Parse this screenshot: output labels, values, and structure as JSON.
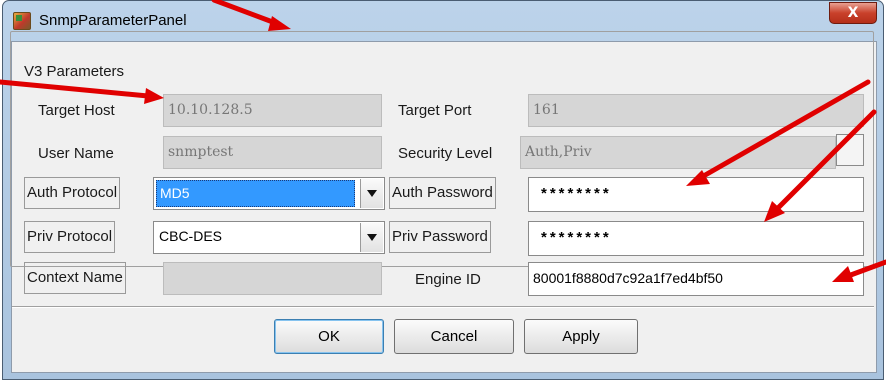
{
  "window": {
    "title": "SnmpParameterPanel",
    "close_glyph": "X"
  },
  "group": {
    "label": "V3 Parameters"
  },
  "fields": {
    "target_host": {
      "label": "Target Host",
      "value": "10.10.128.5"
    },
    "target_port": {
      "label": "Target Port",
      "value": "161"
    },
    "user_name": {
      "label": "User Name",
      "value": "snmptest"
    },
    "security_level": {
      "label": "Security Level",
      "value": "Auth,Priv"
    },
    "auth_protocol": {
      "label": "Auth Protocol",
      "value": "MD5"
    },
    "auth_password": {
      "label": "Auth Password",
      "value": "********"
    },
    "priv_protocol": {
      "label": "Priv Protocol",
      "value": "CBC-DES"
    },
    "priv_password": {
      "label": "Priv Password",
      "value": "********"
    },
    "context_name": {
      "label": "Context Name",
      "value": ""
    },
    "engine_id": {
      "label": "Engine ID",
      "value": "80001f8880d7c92a1f7ed4bf50"
    }
  },
  "buttons": {
    "ok": "OK",
    "cancel": "Cancel",
    "apply": "Apply"
  },
  "icons": {
    "app": "app-icon",
    "close": "close-icon",
    "dropdown": "chevron-down-icon"
  },
  "colors": {
    "annotation_arrow": "#e00000",
    "selection": "#3399ff",
    "titlebar": "#bcd3ea"
  }
}
